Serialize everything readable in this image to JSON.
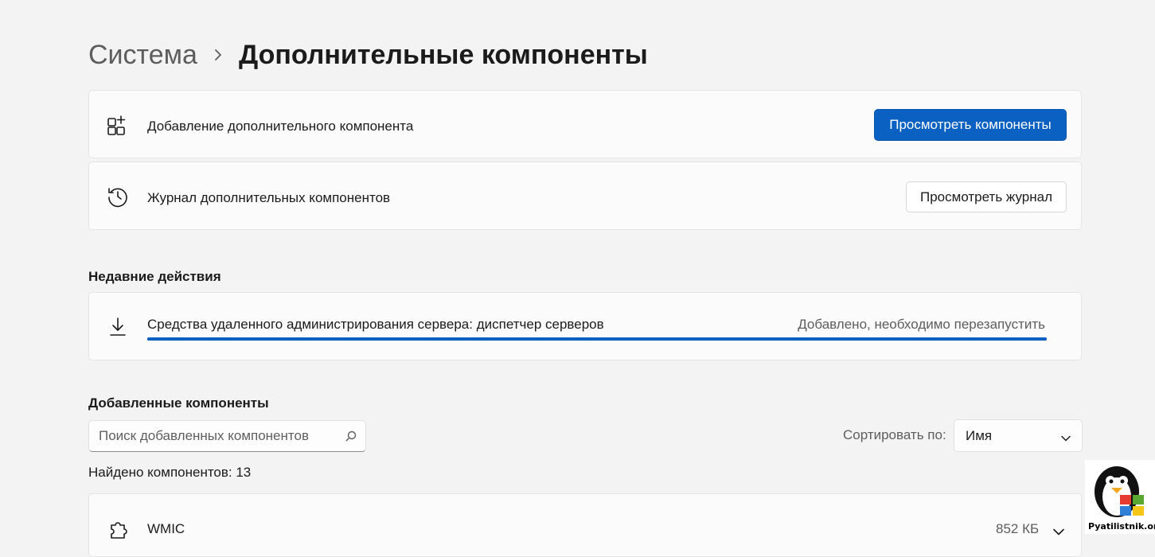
{
  "breadcrumb": {
    "parent": "Система",
    "current": "Дополнительные компоненты"
  },
  "add_card": {
    "icon": "apps-add-icon",
    "label": "Добавление дополнительного компонента",
    "button": "Просмотреть компоненты"
  },
  "history_card": {
    "icon": "history-icon",
    "label": "Журнал дополнительных компонентов",
    "button": "Просмотреть журнал"
  },
  "recent": {
    "title": "Недавние действия",
    "items": [
      {
        "icon": "download-icon",
        "name": "Средства удаленного администрирования сервера: диспетчер серверов",
        "status": "Добавлено, необходимо перезапустить",
        "progress": 1.0
      }
    ]
  },
  "installed": {
    "title": "Добавленные компоненты",
    "search_placeholder": "Поиск добавленных компонентов",
    "sort_label": "Сортировать по:",
    "sort_value": "Имя",
    "found_text": "Найдено компонентов: 13",
    "items": [
      {
        "icon": "puzzle-icon",
        "name": "WMIC",
        "size": "852 КБ"
      }
    ]
  },
  "watermark": {
    "text": "Pyatilistnik.org"
  },
  "colors": {
    "accent": "#0a61c2",
    "background": "#f3f3f3",
    "card": "#fbfbfb"
  }
}
